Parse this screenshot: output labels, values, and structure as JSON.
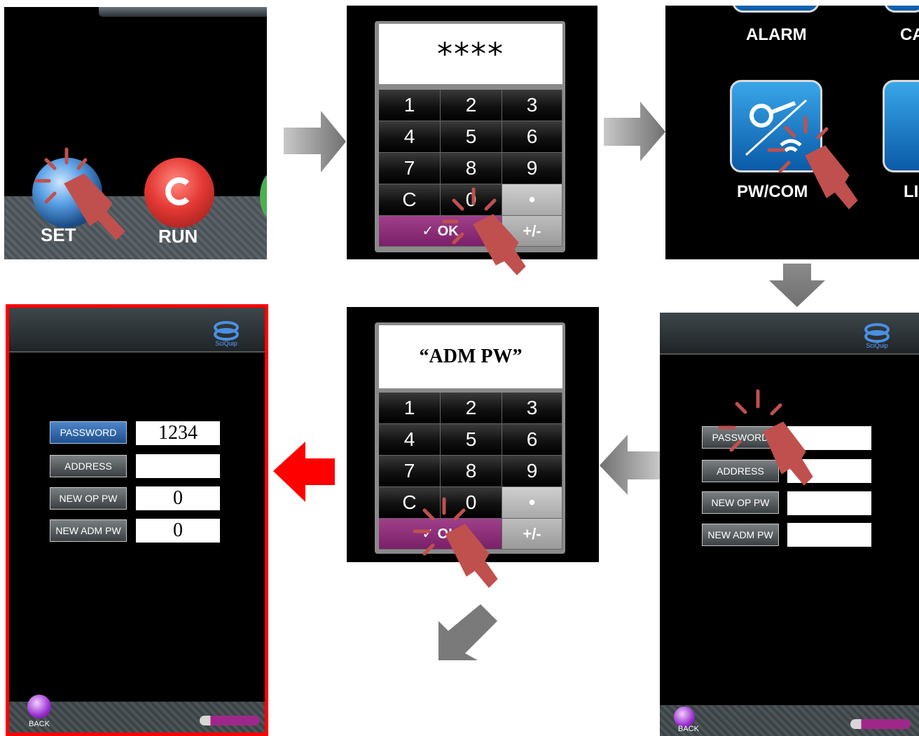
{
  "panel1": {
    "set_label": "SET",
    "run_label": "RUN"
  },
  "keypad1": {
    "display": "****",
    "keys": [
      "1",
      "2",
      "3",
      "4",
      "5",
      "6",
      "7",
      "8",
      "9",
      "C",
      "0",
      "•"
    ],
    "ok_label": "✓ OK",
    "pm_label": "+/-"
  },
  "panel3": {
    "alarm_label": "ALARM",
    "ca_label": "CA",
    "pwcom_label": "PW/COM",
    "li_label": "LI"
  },
  "settings_right": {
    "buttons": [
      "PASSWORD",
      "ADDRESS",
      "NEW OP PW",
      "NEW ADM PW"
    ],
    "values": [
      "",
      "",
      "",
      ""
    ],
    "logo_text": "SciQuip",
    "back_label": "BACK"
  },
  "keypad2": {
    "display": "“ADM PW”",
    "keys": [
      "1",
      "2",
      "3",
      "4",
      "5",
      "6",
      "7",
      "8",
      "9",
      "C",
      "0",
      "•"
    ],
    "ok_label": "✓ OK",
    "pm_label": "+/-"
  },
  "settings_final": {
    "buttons": [
      "PASSWORD",
      "ADDRESS",
      "NEW OP PW",
      "NEW ADM PW"
    ],
    "values": [
      "1234",
      "",
      "0",
      "0"
    ],
    "logo_text": "SciQuip",
    "back_label": "BACK"
  },
  "colors": {
    "highlight_border": "#ff0000",
    "arrow_gray": "#8a8a8a",
    "arrow_red": "#ff0000",
    "tap_hand": "#c0504d"
  }
}
